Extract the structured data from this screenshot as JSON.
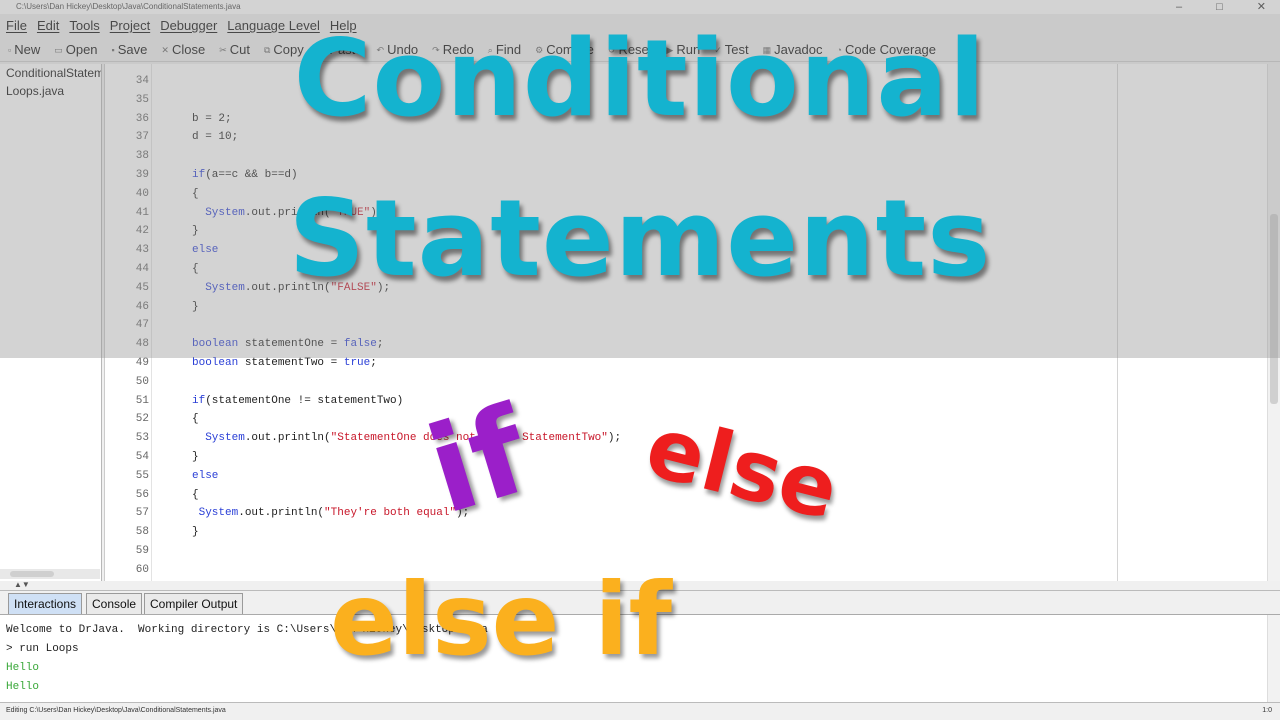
{
  "window": {
    "title": "C:\\Users\\Dan Hickey\\Desktop\\Java\\ConditionalStatements.java",
    "minimize": "–",
    "maximize": "□",
    "close": "✕"
  },
  "menubar": {
    "items": [
      "File",
      "Edit",
      "Tools",
      "Project",
      "Debugger",
      "Language Level",
      "Help"
    ]
  },
  "toolbar": {
    "items": [
      {
        "label": "New",
        "icon": "new-file-icon"
      },
      {
        "label": "Open",
        "icon": "open-folder-icon"
      },
      {
        "label": "Save",
        "icon": "save-icon"
      },
      {
        "label": "Close",
        "icon": "close-file-icon"
      },
      {
        "label": "Cut",
        "icon": "cut-icon"
      },
      {
        "label": "Copy",
        "icon": "copy-icon"
      },
      {
        "label": "Paste",
        "icon": "paste-icon"
      },
      {
        "label": "Undo",
        "icon": "undo-icon"
      },
      {
        "label": "Redo",
        "icon": "redo-icon"
      },
      {
        "label": "Find",
        "icon": "find-icon"
      },
      {
        "label": "Compile",
        "icon": "compile-icon"
      },
      {
        "label": "Reset",
        "icon": "reset-icon"
      },
      {
        "label": "Run",
        "icon": "run-icon"
      },
      {
        "label": "Test",
        "icon": "test-icon"
      },
      {
        "label": "Javadoc",
        "icon": "javadoc-icon"
      },
      {
        "label": "Code Coverage",
        "icon": "coverage-icon"
      }
    ]
  },
  "sidebar": {
    "files": [
      "ConditionalStatements.java",
      "Loops.java"
    ]
  },
  "editor": {
    "lines": [
      {
        "n": "34",
        "code": ""
      },
      {
        "n": "35",
        "code": ""
      },
      {
        "n": "36",
        "code": "b = 2;"
      },
      {
        "n": "37",
        "code": "d = 10;"
      },
      {
        "n": "38",
        "code": ""
      },
      {
        "n": "39",
        "code": "if(a==c && b==d)"
      },
      {
        "n": "40",
        "code": "{"
      },
      {
        "n": "41",
        "code": "  System.out.println(\"TRUE\");"
      },
      {
        "n": "42",
        "code": "}"
      },
      {
        "n": "43",
        "code": "else"
      },
      {
        "n": "44",
        "code": "{"
      },
      {
        "n": "45",
        "code": "  System.out.println(\"FALSE\");"
      },
      {
        "n": "46",
        "code": "}"
      },
      {
        "n": "47",
        "code": ""
      },
      {
        "n": "48",
        "code": "boolean statementOne = false;"
      },
      {
        "n": "49",
        "code": "boolean statementTwo = true;"
      },
      {
        "n": "50",
        "code": ""
      },
      {
        "n": "51",
        "code": "if(statementOne != statementTwo)"
      },
      {
        "n": "52",
        "code": "{"
      },
      {
        "n": "53",
        "code": "  System.out.println(\"StatementOne does not equal StatementTwo\");"
      },
      {
        "n": "54",
        "code": "}"
      },
      {
        "n": "55",
        "code": "else"
      },
      {
        "n": "56",
        "code": "{"
      },
      {
        "n": "57",
        "code": " System.out.println(\"They're both equal\");"
      },
      {
        "n": "58",
        "code": "}"
      },
      {
        "n": "59",
        "code": ""
      },
      {
        "n": "60",
        "code": ""
      }
    ]
  },
  "bottom_tabs": [
    "Interactions",
    "Console",
    "Compiler Output"
  ],
  "console": {
    "lines": [
      {
        "text": "Welcome to DrJava.  Working directory is C:\\Users\\Dan Hickey\\Desktop\\Java",
        "style": "normal"
      },
      {
        "text": "> run Loops",
        "style": "normal"
      },
      {
        "text": "Hello",
        "style": "green"
      },
      {
        "text": "Hello",
        "style": "green"
      }
    ]
  },
  "statusbar": {
    "text": "Editing C:\\Users\\Dan Hickey\\Desktop\\Java\\ConditionalStatements.java",
    "position": "1:0"
  },
  "overlay": {
    "title_line1": "Conditional",
    "title_line2": "Statements",
    "keyword_if": "if",
    "keyword_else": "else",
    "keyword_else_if": "else if",
    "colors": {
      "title": "#14b3cf",
      "if": "#9b1fc9",
      "else": "#ee1e1e",
      "else_if": "#fbb01e"
    }
  }
}
